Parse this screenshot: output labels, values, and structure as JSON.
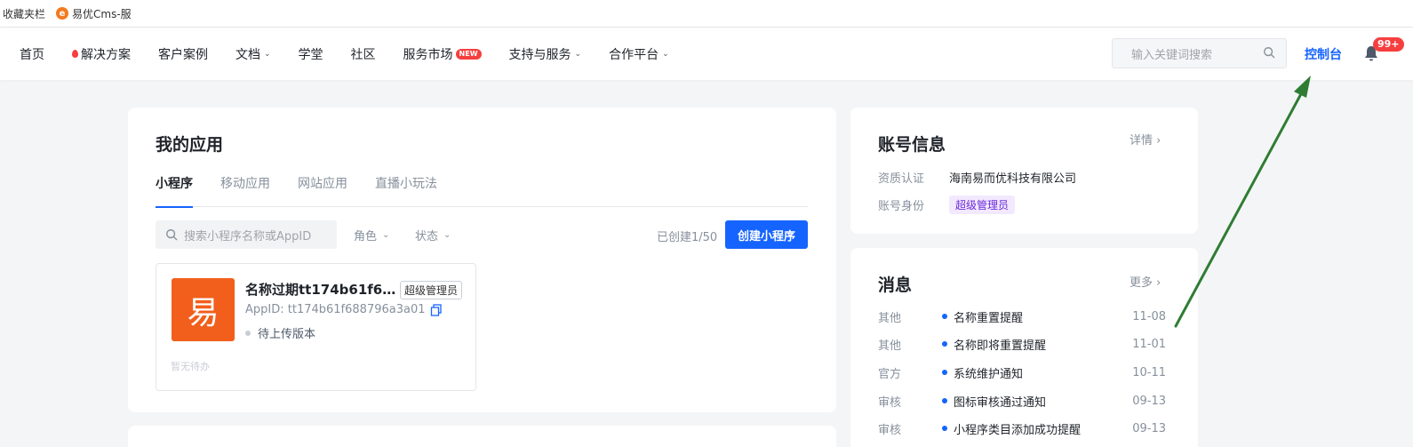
{
  "bookmarks": {
    "folder_label": "收藏夹栏",
    "site_label": "易优Cms-服",
    "site_favicon_char": "e"
  },
  "nav": {
    "links": [
      {
        "label": "首页",
        "hot": false,
        "dropdown": false
      },
      {
        "label": "解决方案",
        "hot": true,
        "dropdown": false
      },
      {
        "label": "客户案例",
        "hot": false,
        "dropdown": false
      },
      {
        "label": "文档",
        "hot": false,
        "dropdown": true
      },
      {
        "label": "学堂",
        "hot": false,
        "dropdown": false
      },
      {
        "label": "社区",
        "hot": false,
        "dropdown": false
      },
      {
        "label": "服务市场",
        "hot": false,
        "dropdown": false,
        "badge": "NEW"
      },
      {
        "label": "支持与服务",
        "hot": false,
        "dropdown": true
      },
      {
        "label": "合作平台",
        "hot": false,
        "dropdown": true
      }
    ],
    "search_placeholder": "输入关键词搜索",
    "console_label": "控制台",
    "notification_count": "99+"
  },
  "apps": {
    "title": "我的应用",
    "tabs": [
      "小程序",
      "移动应用",
      "网站应用",
      "直播小玩法"
    ],
    "active_tab": 0,
    "search_placeholder": "搜索小程序名称或AppID",
    "filter_role": "角色",
    "filter_status": "状态",
    "created_count": "已创建1/50",
    "create_button": "创建小程序",
    "item": {
      "logo_char": "易",
      "name": "名称过期tt174b61f688...",
      "role": "超级管理员",
      "app_id": "AppID: tt174b61f688796a3a01",
      "status": "待上传版本",
      "todo": "暂无待办"
    }
  },
  "account": {
    "title": "账号信息",
    "detail_link": "详情",
    "rows": [
      {
        "label": "资质认证",
        "value": "海南易而优科技有限公司"
      },
      {
        "label": "账号身份",
        "value": "超级管理员"
      }
    ]
  },
  "messages": {
    "title": "消息",
    "more_link": "更多",
    "items": [
      {
        "category": "其他",
        "title": "名称重置提醒",
        "date": "11-08"
      },
      {
        "category": "其他",
        "title": "名称即将重置提醒",
        "date": "11-01"
      },
      {
        "category": "官方",
        "title": "系统维护通知",
        "date": "10-11"
      },
      {
        "category": "审核",
        "title": "图标审核通过通知",
        "date": "09-13"
      },
      {
        "category": "审核",
        "title": "小程序类目添加成功提醒",
        "date": "09-13"
      }
    ]
  },
  "colors": {
    "primary": "#1664ff",
    "alert": "#f53f3f",
    "app_logo": "#f25f1c",
    "arrow": "#2e7d32"
  }
}
